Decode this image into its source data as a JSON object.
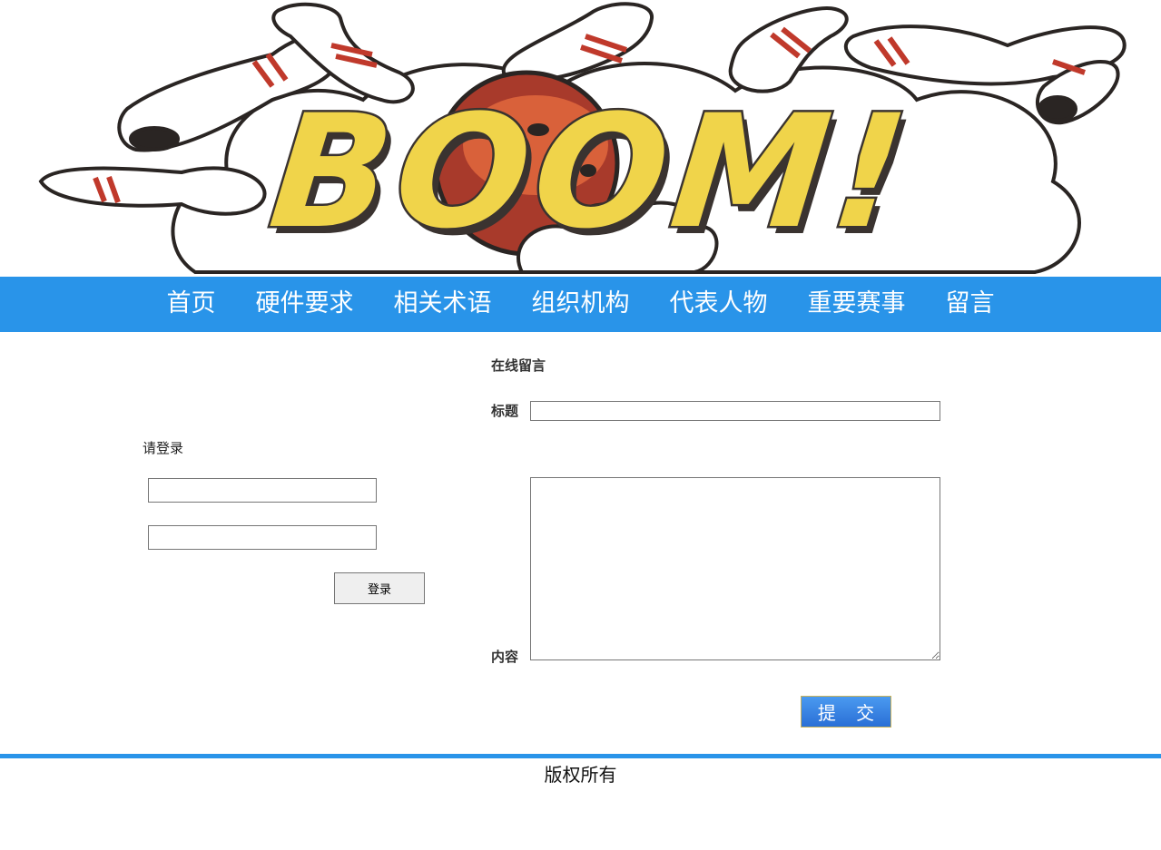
{
  "nav": {
    "items": [
      {
        "label": "首页"
      },
      {
        "label": "硬件要求"
      },
      {
        "label": "相关术语"
      },
      {
        "label": "组织机构"
      },
      {
        "label": "代表人物"
      },
      {
        "label": "重要赛事"
      },
      {
        "label": "留言"
      }
    ],
    "color": "#2994e9"
  },
  "banner": {
    "word": "BOOM!",
    "icons": [
      "bowling-pin-icon",
      "bowling-ball-icon",
      "smoke-cloud-icon"
    ]
  },
  "login": {
    "heading": "请登录",
    "username_value": "",
    "password_value": "",
    "button_label": "登录"
  },
  "message": {
    "heading": "在线留言",
    "title_label": "标题",
    "title_value": "",
    "content_label": "内容",
    "content_value": "",
    "submit_label": "提 交"
  },
  "footer": {
    "copyright": "版权所有"
  }
}
